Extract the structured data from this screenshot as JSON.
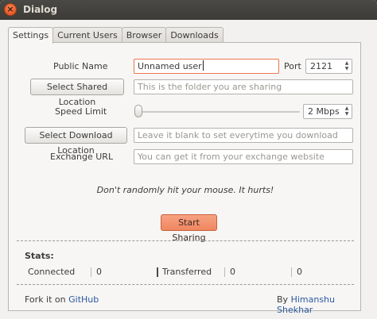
{
  "window": {
    "title": "Dialog",
    "close_glyph": "×"
  },
  "tabs": [
    {
      "label": "Settings",
      "active": true
    },
    {
      "label": "Current Users",
      "active": false
    },
    {
      "label": "Browser",
      "active": false
    },
    {
      "label": "Downloads",
      "active": false
    }
  ],
  "settings": {
    "public_name_label": "Public Name",
    "public_name_value": "Unnamed user",
    "port_label": "Port",
    "port_value": "2121",
    "select_shared_button": "Select Shared Location",
    "shared_placeholder": "This is the folder you are sharing",
    "speed_label": "Speed Limit",
    "speed_value": "2 Mbps",
    "speed_level": 0.0,
    "select_download_button": "Select Download Location",
    "download_placeholder": "Leave it blank to set everytime you download",
    "exchange_label": "Exchange URL",
    "exchange_placeholder": "You can get it from your exchange website",
    "hint": "Don't randomly hit your mouse. It hurts!",
    "start_button": "Start Sharing"
  },
  "stats": {
    "title": "Stats:",
    "connected_label": "Connected",
    "connected_value": "0",
    "transferred_label": "Transferred",
    "transferred_value": "0",
    "extra_value": "0"
  },
  "footer": {
    "fork_text": "Fork it on",
    "github_link": "GitHub",
    "by_text": "By",
    "author_link": "Himanshu Shekhar"
  },
  "colors": {
    "accent": "#ef8660",
    "titlebar": "#3c3b37",
    "close": "#df4a16",
    "link": "#2c5aa0"
  }
}
